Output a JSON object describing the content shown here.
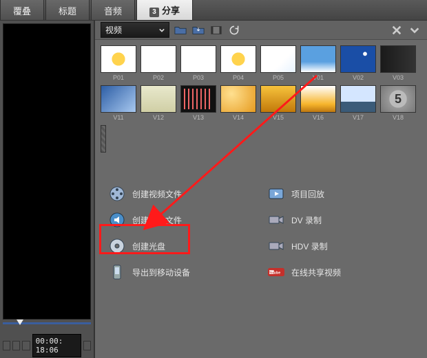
{
  "tabs": {
    "overlay": "覆叠",
    "title": "标题",
    "audio": "音频",
    "share_num": "3",
    "share": "分享"
  },
  "preview": {
    "timecode": "00:00: 18:06"
  },
  "library": {
    "dropdown_label": "视频",
    "thumbs": [
      {
        "label": "P01",
        "cls": "t-p01"
      },
      {
        "label": "P02",
        "cls": "t-p02"
      },
      {
        "label": "P03",
        "cls": "t-p03"
      },
      {
        "label": "P04",
        "cls": "t-p04"
      },
      {
        "label": "P05",
        "cls": "t-p05"
      },
      {
        "label": "V01",
        "cls": "t-v01"
      },
      {
        "label": "V02",
        "cls": "t-v02"
      },
      {
        "label": "V03",
        "cls": "t-v03"
      },
      {
        "label": "V11",
        "cls": "t-v11"
      },
      {
        "label": "V12",
        "cls": "t-v12"
      },
      {
        "label": "V13",
        "cls": "t-v13"
      },
      {
        "label": "V14",
        "cls": "t-v14"
      },
      {
        "label": "V15",
        "cls": "t-v15"
      },
      {
        "label": "V16",
        "cls": "t-v16"
      },
      {
        "label": "V17",
        "cls": "t-v17"
      },
      {
        "label": "V18",
        "cls": "t-v18"
      }
    ]
  },
  "actions": {
    "create_video": "创建视频文件",
    "create_audio": "创建声音文件",
    "create_disc": "创建光盘",
    "export_mobile": "导出到移动设备",
    "project_playback": "项目回放",
    "dv_record": "DV 录制",
    "hdv_record": "HDV 录制",
    "online_share": "在线共享视频"
  }
}
